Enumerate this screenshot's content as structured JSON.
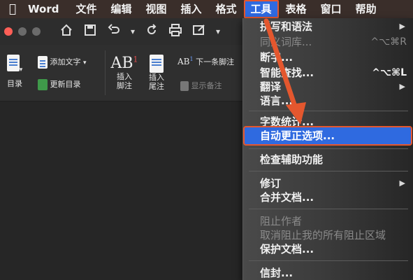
{
  "menubar": {
    "apple_icon": "apple-icon",
    "items": [
      "Word",
      "文件",
      "编辑",
      "视图",
      "插入",
      "格式",
      "工具",
      "表格",
      "窗口",
      "帮助"
    ]
  },
  "toolbar": {
    "icons": [
      "home-icon",
      "save-icon",
      "undo-icon",
      "redo-icon",
      "print-icon",
      "edit-icon",
      "more-icon"
    ],
    "traffic_colors": [
      "#ff5f57",
      "#6b6b6b",
      "#6b6b6b"
    ]
  },
  "ribbon": {
    "toc_label": "目录",
    "add_text": "添加文字",
    "update_toc": "更新目录",
    "insert_footnote": "插入\n脚注",
    "insert_endnote": "插入\n尾注",
    "next_footnote": "下一条脚注",
    "show_notes": "显示备注"
  },
  "tools_menu": {
    "items": [
      {
        "label": "拼写和语法",
        "shortcut": "",
        "submenu": true,
        "disabled": false
      },
      {
        "label": "同义词库...",
        "shortcut": "^⌥⌘R",
        "submenu": false,
        "disabled": true
      },
      {
        "label": "断字...",
        "shortcut": "",
        "submenu": false,
        "disabled": false
      },
      {
        "label": "智能查找...",
        "shortcut": "^⌥⌘L",
        "submenu": false,
        "disabled": false
      },
      {
        "label": "翻译",
        "shortcut": "",
        "submenu": true,
        "disabled": false
      },
      {
        "label": "语言...",
        "shortcut": "",
        "submenu": false,
        "disabled": false
      },
      {
        "label": "字数统计...",
        "shortcut": "",
        "submenu": false,
        "disabled": false
      },
      {
        "label": "自动更正选项...",
        "shortcut": "",
        "submenu": false,
        "disabled": false,
        "highlighted": true
      },
      {
        "label": "检查辅助功能",
        "shortcut": "",
        "submenu": false,
        "disabled": false
      },
      {
        "label": "修订",
        "shortcut": "",
        "submenu": true,
        "disabled": false
      },
      {
        "label": "合并文档...",
        "shortcut": "",
        "submenu": false,
        "disabled": false
      },
      {
        "label": "阻止作者",
        "shortcut": "",
        "submenu": false,
        "disabled": true
      },
      {
        "label": "取消阻止我的所有阻止区域",
        "shortcut": "",
        "submenu": false,
        "disabled": true
      },
      {
        "label": "保护文档...",
        "shortcut": "",
        "submenu": false,
        "disabled": false
      },
      {
        "label": "信封...",
        "shortcut": "",
        "submenu": false,
        "disabled": false
      }
    ],
    "submenu_arrow": "▶"
  },
  "colors": {
    "accent_blue": "#2f6ae0",
    "annotation_orange": "#e4572e"
  }
}
